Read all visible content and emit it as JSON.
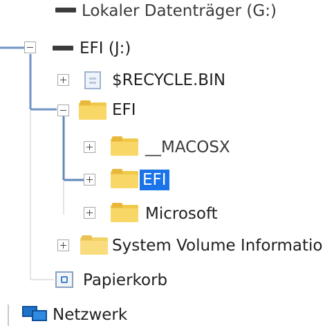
{
  "tree": {
    "drive_g_label": "Lokaler Datenträger (G:)",
    "drive_efi_label": "EFI (J:)",
    "recycle_label": "$RECYCLE.BIN",
    "efi_folder_label": "EFI",
    "macosx_label": "__MACOSX",
    "efi_sub_label": "EFI",
    "microsoft_label": "Microsoft",
    "sysvol_label": "System Volume Informatio",
    "papierkorb_label": "Papierkorb",
    "network_label": "Netzwerk"
  },
  "selected_item": "EFI",
  "colors": {
    "selection": "#1a73e8",
    "tree_line_highlight": "#5f86b8",
    "folder": "#f8d767"
  }
}
